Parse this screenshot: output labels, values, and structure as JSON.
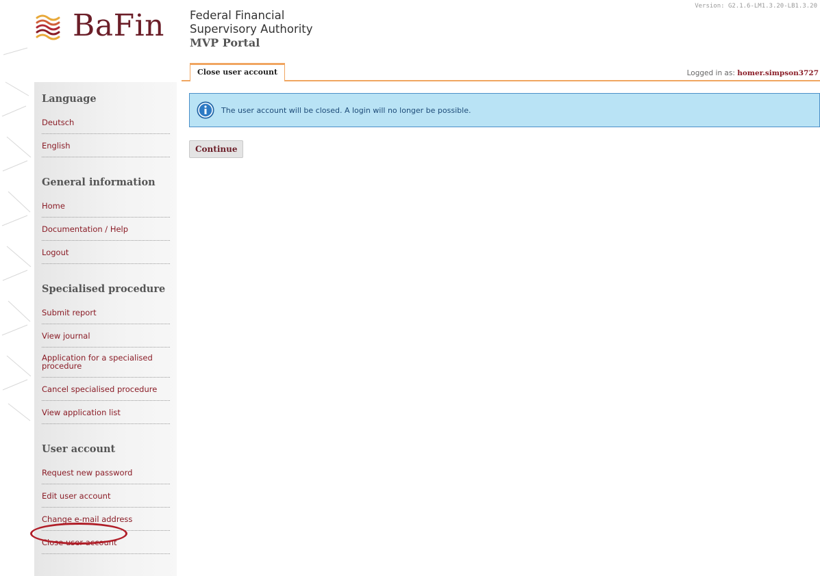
{
  "version": "Version: G2.1.6-LM1.3.20-LB1.3.20",
  "logo": {
    "text": "BaFin",
    "icon": "bafin-waves-logo"
  },
  "header": {
    "line1": "Federal Financial",
    "line2": "Supervisory Authority",
    "portal": "MVP Portal"
  },
  "tab": {
    "label": "Close user account"
  },
  "login": {
    "prefix": "Logged in as:",
    "user": "homer.simpson3727"
  },
  "sidebar": {
    "language": {
      "heading": "Language",
      "items": [
        "Deutsch",
        "English"
      ]
    },
    "general": {
      "heading": "General information",
      "items": [
        "Home",
        "Documentation / Help",
        "Logout"
      ]
    },
    "specialised": {
      "heading": "Specialised procedure",
      "items": [
        "Submit report",
        "View journal",
        "Application for a specialised procedure",
        "Cancel specialised procedure",
        "View application list"
      ]
    },
    "account": {
      "heading": "User account",
      "items": [
        "Request new password",
        "Edit user account",
        "Change e-mail address",
        "Close user account"
      ]
    }
  },
  "message": {
    "icon": "info-icon",
    "text": "The user account will be closed. A login will no longer be possible."
  },
  "continue_label": "Continue",
  "colors": {
    "accent": "#8a1c26",
    "tab_border": "#f0a560",
    "info_bg": "#b9e3f5",
    "highlight": "#b01e28"
  }
}
